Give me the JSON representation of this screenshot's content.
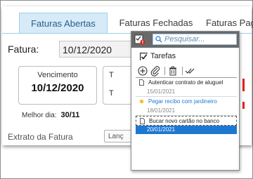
{
  "tabs": [
    "Faturas Abertas",
    "Faturas Fechadas",
    "Faturas Pagas"
  ],
  "fatura": {
    "label": "Fatura:",
    "value": "10/12/2020"
  },
  "vencimento": {
    "title": "Vencimento",
    "value": "10/12/2020"
  },
  "card2": {
    "line1": "T",
    "line2": "T"
  },
  "melhor_dia": {
    "label": "Melhor dia:",
    "value": "30/11"
  },
  "extrato": {
    "label": "Extrato da Fatura",
    "button": "Lanç"
  },
  "popup": {
    "search_placeholder": "Pesquisar...",
    "section_label": "Tarefas",
    "tasks": [
      {
        "title": "Autenticar contrato de aluguel",
        "date": "15/01/2021",
        "icon": "document-icon",
        "color": "#222222"
      },
      {
        "title": "Pegar recibo com jardineiro",
        "date": "18/01/2021",
        "icon": "star-icon",
        "color": "#1e78d2"
      },
      {
        "title": "Bucar novo cartão no banco",
        "date": "20/01/2021",
        "icon": "document-icon",
        "color": "#222222",
        "selected": true
      }
    ]
  },
  "colors": {
    "accent": "#1e78d2",
    "tab_active_bg": "#d6ebf7",
    "popup_bar": "#6a6a6a",
    "alert": "#e02020"
  }
}
